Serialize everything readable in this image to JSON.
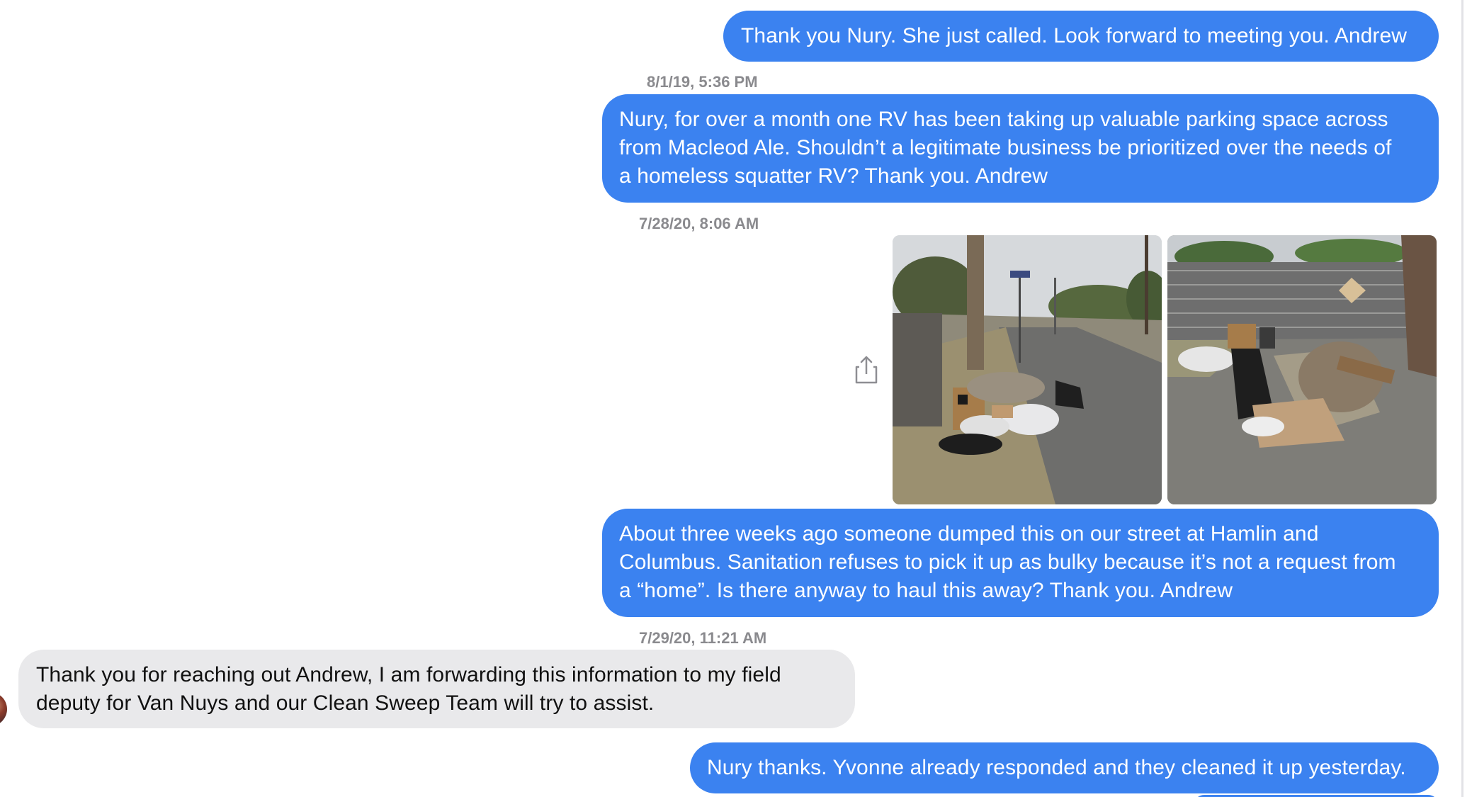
{
  "conversation": {
    "messages": [
      {
        "id": "m1",
        "direction": "outgoing",
        "lines": [
          "Thank you Nury. She just called. Look forward to meeting you. Andrew"
        ]
      },
      {
        "id": "m2",
        "direction": "outgoing",
        "timestamp": "8/1/19, 5:36 PM",
        "lines": [
          "Nury, for over a month one RV has been taking up valuable parking space across",
          "from Macleod Ale. Shouldn’t a legitimate business be prioritized over the needs of",
          "a homeless squatter RV? Thank you. Andrew"
        ]
      },
      {
        "id": "m3",
        "direction": "outgoing",
        "timestamp": "7/28/20, 8:06 AM",
        "attachments": [
          "street-debris-photo",
          "fence-debris-photo"
        ]
      },
      {
        "id": "m4",
        "direction": "outgoing",
        "lines": [
          "About three weeks ago someone dumped this on our street at Hamlin and",
          "Columbus. Sanitation refuses to pick it up as bulky because it’s not a request from",
          "a “home”.  Is there anyway to haul this away? Thank you. Andrew"
        ]
      },
      {
        "id": "m5",
        "direction": "incoming",
        "timestamp": "7/29/20, 11:21 AM",
        "lines": [
          "Thank you for reaching out Andrew, I am forwarding this information to my field",
          "deputy for Van Nuys and our Clean Sweep Team will try to assist."
        ]
      },
      {
        "id": "m6",
        "direction": "outgoing",
        "lines": [
          "Nury thanks. Yvonne already responded and they cleaned it up yesterday."
        ]
      }
    ],
    "share_icon": "share-icon",
    "colors": {
      "outgoing_bubble": "#3b82f0",
      "incoming_bubble": "#e9e9eb",
      "timestamp_text": "#8a8a8e"
    }
  }
}
